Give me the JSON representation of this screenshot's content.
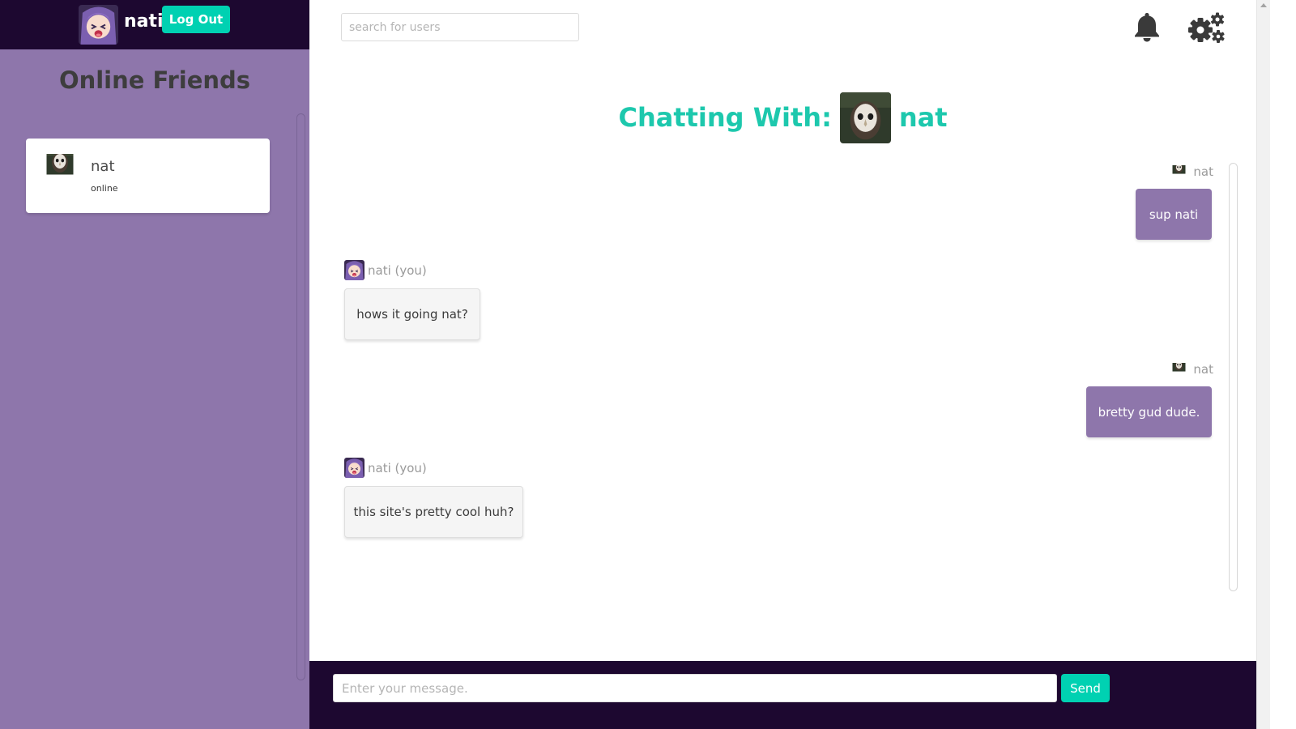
{
  "sidebar": {
    "current_user": "nati",
    "logout_label": "Log Out",
    "friends_title": "Online Friends",
    "friends": [
      {
        "name": "nat",
        "status": "online"
      }
    ]
  },
  "topbar": {
    "search_placeholder": "search for users",
    "icons": [
      "bell-icon",
      "gears-icon"
    ]
  },
  "chat": {
    "header_label": "Chatting With:",
    "partner_name": "nat",
    "messages": [
      {
        "sender": "nat",
        "text": "sup nati",
        "direction": "incoming"
      },
      {
        "sender": "nati (you)",
        "text": "hows it going nat?",
        "direction": "outgoing"
      },
      {
        "sender": "nat",
        "text": "bretty gud dude.",
        "direction": "incoming"
      },
      {
        "sender": "nati (you)",
        "text": "this site's pretty cool huh?",
        "direction": "outgoing"
      }
    ]
  },
  "composer": {
    "placeholder": "Enter your message.",
    "send_label": "Send"
  },
  "colors": {
    "sidebar_bg": "#8e76ab",
    "dark_bar": "#1d0830",
    "accent": "#00d1b2",
    "incoming_bubble": "#8e76ab"
  }
}
